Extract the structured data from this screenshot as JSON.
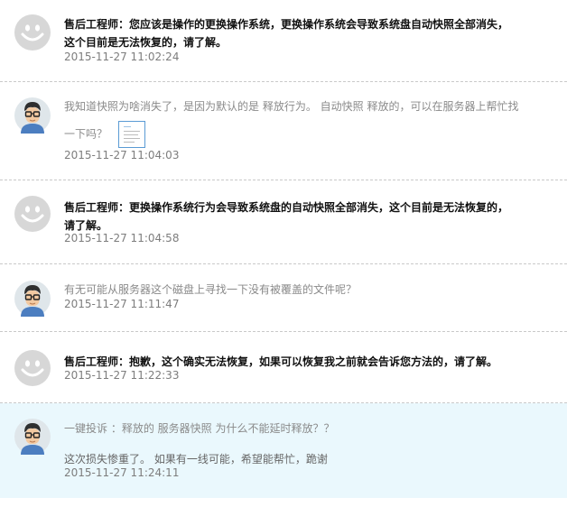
{
  "messages": [
    {
      "role": "agent",
      "author": "售后工程师",
      "separator": "：",
      "lines": [
        "您应该是操作的更换操作系统，更换操作系统会导致系统盘自动快照全部消失，",
        "这个目前是无法恢复的，请了解。"
      ],
      "time": "2015-11-27 11:02:24"
    },
    {
      "role": "user",
      "lines": [
        "我知道快照为啥消失了，是因为默认的是 释放行为。  自动快照 释放的，可以在服务器上帮忙找",
        "一下吗？"
      ],
      "time": "2015-11-27 11:04:03"
    },
    {
      "role": "agent",
      "author": "售后工程师",
      "separator": "：",
      "lines": [
        "更换操作系统行为会导致系统盘的自动快照全部消失，这个目前是无法恢复的，",
        "请了解。"
      ],
      "time": "2015-11-27 11:04:58"
    },
    {
      "role": "user",
      "lines": [
        "有无可能从服务器这个磁盘上寻找一下没有被覆盖的文件呢？"
      ],
      "time": "2015-11-27 11:11:47"
    },
    {
      "role": "agent",
      "author": "售后工程师",
      "separator": "：",
      "lines": [
        "抱歉，这个确实无法恢复，如果可以恢复我之前就会告诉您方法的，请了解。"
      ],
      "time": "2015-11-27 11:22:33"
    },
    {
      "role": "user",
      "lines": [
        "一键投诉 ：释放的 服务器快照  为什么不能延时释放？？",
        "",
        "这次损失惨重了。    如果有一线可能，希望能帮忙，跪谢"
      ],
      "time": "2015-11-27 11:24:11"
    }
  ]
}
